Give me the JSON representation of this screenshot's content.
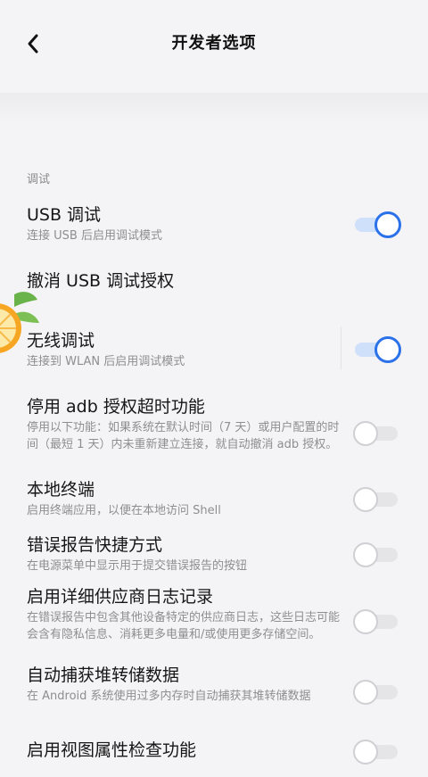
{
  "header": {
    "title": "开发者选项"
  },
  "section": {
    "label": "调试"
  },
  "items": [
    {
      "title": "USB 调试",
      "subtitle": "连接 USB 后启用调试模式",
      "toggle": "on"
    },
    {
      "title": "撤消 USB 调试授权",
      "subtitle": ""
    },
    {
      "title": "无线调试",
      "subtitle": "连接到 WLAN 后启用调试模式",
      "toggle": "on"
    },
    {
      "title": "停用 adb 授权超时功能",
      "subtitle": "停用以下功能：如果系统在默认时间（7 天）或用户配置的时间（最短 1 天）内未重新建立连接，就自动撤消 adb 授权。",
      "toggle": "off"
    },
    {
      "title": "本地终端",
      "subtitle": "启用终端应用，以便在本地访问 Shell",
      "toggle": "off"
    },
    {
      "title": "错误报告快捷方式",
      "subtitle": "在电源菜单中显示用于提交错误报告的按钮",
      "toggle": "off"
    },
    {
      "title": "启用详细供应商日志记录",
      "subtitle": "在错误报告中包含其他设备特定的供应商日志，这些日志可能会含有隐私信息、消耗更多电量和/或使用更多存储空间。",
      "toggle": "off"
    },
    {
      "title": "自动捕获堆转储数据",
      "subtitle": "在 Android 系统使用过多内存时自动捕获其堆转储数据",
      "toggle": "off"
    },
    {
      "title": "启用视图属性检查功能",
      "subtitle": "",
      "toggle": "off"
    }
  ],
  "colors": {
    "accent": "#2b72ea",
    "background": "#f4f4f6"
  }
}
